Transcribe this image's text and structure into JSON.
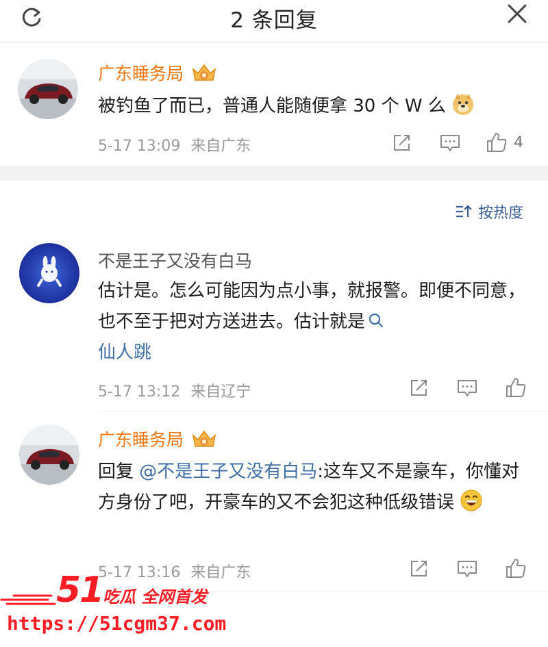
{
  "header": {
    "title": "2 条回复",
    "refresh_icon": "refresh-icon",
    "close_icon": "close-icon"
  },
  "root_comment": {
    "username": "广东睡务局",
    "badge_icon": "crown-badge-icon",
    "text": "被钓鱼了而已，普通人能随便拿 30 个 W 么",
    "emoji_icon": "doge-emoji-icon",
    "time": "5-17 13:09",
    "location": "来自广东",
    "like_count": "4"
  },
  "sort": {
    "label": "按热度",
    "icon": "sort-icon"
  },
  "replies": [
    {
      "username": "不是王子又没有白马",
      "text": "估计是。怎么可能因为点小事，就报警。即便不同意，也不至于把对方送进去。估计就是",
      "search_link": "仙人跳",
      "time": "5-17 13:12",
      "location": "来自辽宁"
    },
    {
      "username": "广东睡务局",
      "badge_icon": "crown-badge-icon",
      "prefix": "回复",
      "mention": "@不是王子又没有白马",
      "text": ":这车又不是豪车，你懂对方身份了吧，开豪车的又不会犯这种低级错误",
      "emoji_icon": "grin-emoji-icon",
      "time": "5-17 13:16",
      "location": "来自广东"
    }
  ],
  "watermark": {
    "number": "51",
    "tag": "吃瓜 全网首发",
    "url": "https://51cgm37.com"
  },
  "colors": {
    "accent_orange": "#f2760f",
    "link_blue": "#3f6ea5",
    "watermark_red": "#ff1d25"
  }
}
